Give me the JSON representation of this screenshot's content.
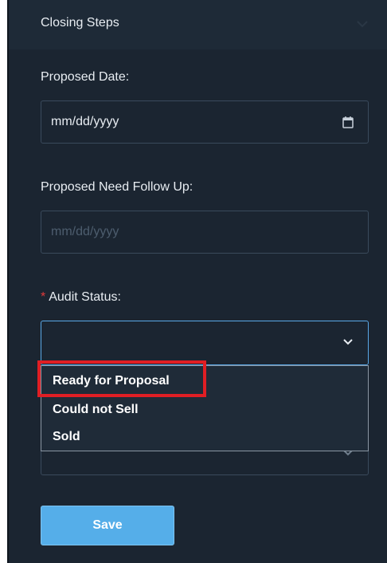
{
  "section": {
    "title": "Closing Steps"
  },
  "fields": {
    "proposed_date": {
      "label": "Proposed Date:",
      "value": "mm/dd/yyyy"
    },
    "proposed_follow_up": {
      "label": "Proposed Need Follow Up:",
      "placeholder": "mm/dd/yyyy"
    },
    "audit_status": {
      "required_marker": "*",
      "label": "Audit Status:",
      "value": "",
      "options": [
        "Ready for Proposal",
        "Could not Sell",
        "Sold"
      ]
    }
  },
  "actions": {
    "save_label": "Save"
  },
  "icons": [
    "chevron-down-icon",
    "calendar-icon"
  ],
  "colors": {
    "panel_bg": "#1b2531",
    "accent": "#55aee9",
    "highlight": "#e01e24",
    "required": "#e03a3a"
  }
}
